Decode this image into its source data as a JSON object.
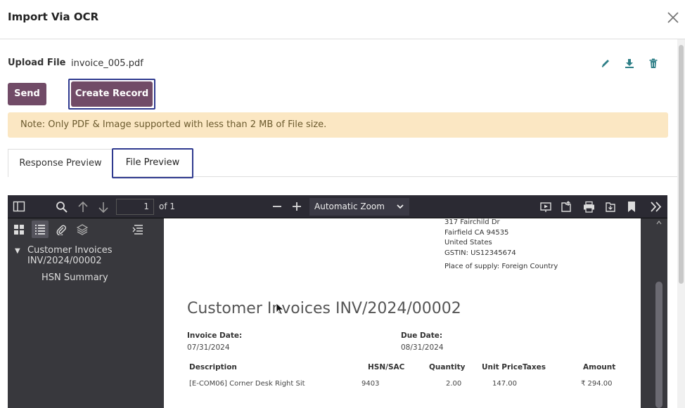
{
  "dialog": {
    "title": "Import Via OCR"
  },
  "upload": {
    "label": "Upload File",
    "file_name": "invoice_005.pdf"
  },
  "actions": {
    "send": "Send",
    "create_record": "Create Record"
  },
  "note": "Note: Only PDF & Image supported with less than 2 MB of File size.",
  "tabs": [
    {
      "label": "Response Preview",
      "active": false
    },
    {
      "label": "File Preview",
      "active": true
    }
  ],
  "viewer": {
    "page_number": "1",
    "page_count": "of 1",
    "zoom": "Automatic Zoom",
    "outline": [
      {
        "title": "Customer Invoices INV/2024/00002"
      },
      {
        "title": "HSN Summary"
      }
    ]
  },
  "invoice": {
    "address": [
      "317 Fairchild Dr",
      "Fairfield CA 94535",
      "United States",
      "GSTIN: US12345674"
    ],
    "place_of_supply": "Place of supply: Foreign Country",
    "title": "Customer Invoices INV/2024/00002",
    "invoice_date_label": "Invoice Date:",
    "invoice_date": "07/31/2024",
    "due_date_label": "Due Date:",
    "due_date": "08/31/2024",
    "columns": {
      "description": "Description",
      "hsn": "HSN/SAC",
      "quantity": "Quantity",
      "unit_price": "Unit Price",
      "taxes": "Taxes",
      "amount": "Amount"
    },
    "rows": [
      {
        "description": "[E-COM06] Corner Desk Right Sit",
        "hsn": "9403",
        "quantity": "2.00",
        "unit_price": "147.00",
        "taxes": "",
        "amount": "₹ 294.00"
      }
    ]
  },
  "colors": {
    "primary": "#714b67",
    "focus": "#2f3a8f",
    "note_bg": "#fbe7c3"
  }
}
